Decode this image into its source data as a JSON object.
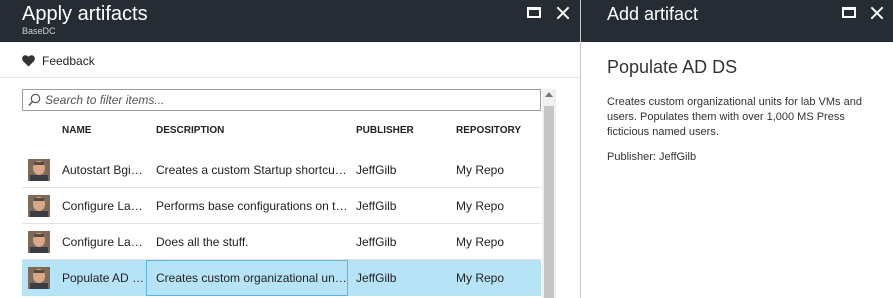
{
  "left_blade": {
    "title": "Apply artifacts",
    "subtitle": "BaseDC",
    "feedback_label": "Feedback",
    "search": {
      "placeholder": "Search to filter items..."
    },
    "columns": [
      "NAME",
      "DESCRIPTION",
      "PUBLISHER",
      "REPOSITORY"
    ],
    "rows": [
      {
        "name": "Autostart Bginfo",
        "description": "Creates a custom Startup shortcut for BGInfo",
        "publisher": "JeffGilb",
        "repository": "My Repo",
        "selected": false
      },
      {
        "name": "Configure Lab Machine",
        "description": "Performs base configurations on the machine",
        "publisher": "JeffGilb",
        "repository": "My Repo",
        "selected": false
      },
      {
        "name": "Configure Lab Domain",
        "description": "Does all the stuff.",
        "publisher": "JeffGilb",
        "repository": "My Repo",
        "selected": false
      },
      {
        "name": "Populate AD DS",
        "description": "Creates custom organizational units for lab VMs",
        "publisher": "JeffGilb",
        "repository": "My Repo",
        "selected": true
      }
    ]
  },
  "right_blade": {
    "title": "Add artifact",
    "artifact_title": "Populate AD DS",
    "artifact_description": "Creates custom organizational units for lab VMs and users. Populates them with over 1,000 MS Press ficticious named users.",
    "publisher_line": "Publisher: JeffGilb"
  },
  "colors": {
    "header_bg": "#262c34",
    "selected_row": "#b7e3f6",
    "focus_border": "#5ab6e6"
  },
  "icons": [
    "maximize-icon",
    "close-icon",
    "heart-icon",
    "search-icon",
    "publisher-avatar-icon"
  ]
}
